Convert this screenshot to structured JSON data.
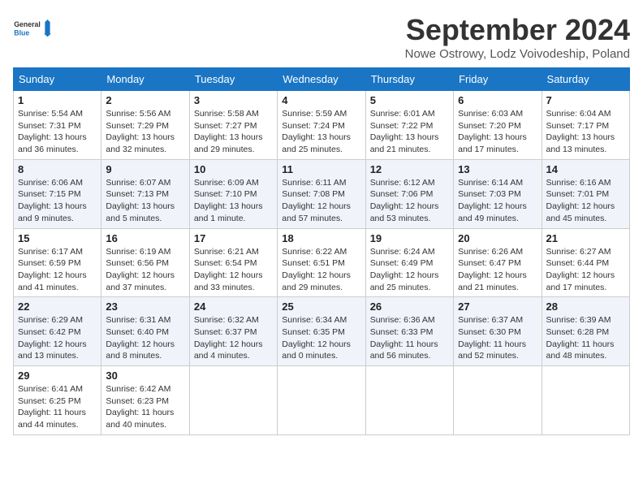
{
  "logo": {
    "line1": "General",
    "line2": "Blue"
  },
  "title": "September 2024",
  "subtitle": "Nowe Ostrowy, Lodz Voivodeship, Poland",
  "days_of_week": [
    "Sunday",
    "Monday",
    "Tuesday",
    "Wednesday",
    "Thursday",
    "Friday",
    "Saturday"
  ],
  "weeks": [
    [
      {
        "day": 1,
        "sunrise": "5:54 AM",
        "sunset": "7:31 PM",
        "daylight": "13 hours and 36 minutes."
      },
      {
        "day": 2,
        "sunrise": "5:56 AM",
        "sunset": "7:29 PM",
        "daylight": "13 hours and 32 minutes."
      },
      {
        "day": 3,
        "sunrise": "5:58 AM",
        "sunset": "7:27 PM",
        "daylight": "13 hours and 29 minutes."
      },
      {
        "day": 4,
        "sunrise": "5:59 AM",
        "sunset": "7:24 PM",
        "daylight": "13 hours and 25 minutes."
      },
      {
        "day": 5,
        "sunrise": "6:01 AM",
        "sunset": "7:22 PM",
        "daylight": "13 hours and 21 minutes."
      },
      {
        "day": 6,
        "sunrise": "6:03 AM",
        "sunset": "7:20 PM",
        "daylight": "13 hours and 17 minutes."
      },
      {
        "day": 7,
        "sunrise": "6:04 AM",
        "sunset": "7:17 PM",
        "daylight": "13 hours and 13 minutes."
      }
    ],
    [
      {
        "day": 8,
        "sunrise": "6:06 AM",
        "sunset": "7:15 PM",
        "daylight": "13 hours and 9 minutes."
      },
      {
        "day": 9,
        "sunrise": "6:07 AM",
        "sunset": "7:13 PM",
        "daylight": "13 hours and 5 minutes."
      },
      {
        "day": 10,
        "sunrise": "6:09 AM",
        "sunset": "7:10 PM",
        "daylight": "13 hours and 1 minute."
      },
      {
        "day": 11,
        "sunrise": "6:11 AM",
        "sunset": "7:08 PM",
        "daylight": "12 hours and 57 minutes."
      },
      {
        "day": 12,
        "sunrise": "6:12 AM",
        "sunset": "7:06 PM",
        "daylight": "12 hours and 53 minutes."
      },
      {
        "day": 13,
        "sunrise": "6:14 AM",
        "sunset": "7:03 PM",
        "daylight": "12 hours and 49 minutes."
      },
      {
        "day": 14,
        "sunrise": "6:16 AM",
        "sunset": "7:01 PM",
        "daylight": "12 hours and 45 minutes."
      }
    ],
    [
      {
        "day": 15,
        "sunrise": "6:17 AM",
        "sunset": "6:59 PM",
        "daylight": "12 hours and 41 minutes."
      },
      {
        "day": 16,
        "sunrise": "6:19 AM",
        "sunset": "6:56 PM",
        "daylight": "12 hours and 37 minutes."
      },
      {
        "day": 17,
        "sunrise": "6:21 AM",
        "sunset": "6:54 PM",
        "daylight": "12 hours and 33 minutes."
      },
      {
        "day": 18,
        "sunrise": "6:22 AM",
        "sunset": "6:51 PM",
        "daylight": "12 hours and 29 minutes."
      },
      {
        "day": 19,
        "sunrise": "6:24 AM",
        "sunset": "6:49 PM",
        "daylight": "12 hours and 25 minutes."
      },
      {
        "day": 20,
        "sunrise": "6:26 AM",
        "sunset": "6:47 PM",
        "daylight": "12 hours and 21 minutes."
      },
      {
        "day": 21,
        "sunrise": "6:27 AM",
        "sunset": "6:44 PM",
        "daylight": "12 hours and 17 minutes."
      }
    ],
    [
      {
        "day": 22,
        "sunrise": "6:29 AM",
        "sunset": "6:42 PM",
        "daylight": "12 hours and 13 minutes."
      },
      {
        "day": 23,
        "sunrise": "6:31 AM",
        "sunset": "6:40 PM",
        "daylight": "12 hours and 8 minutes."
      },
      {
        "day": 24,
        "sunrise": "6:32 AM",
        "sunset": "6:37 PM",
        "daylight": "12 hours and 4 minutes."
      },
      {
        "day": 25,
        "sunrise": "6:34 AM",
        "sunset": "6:35 PM",
        "daylight": "12 hours and 0 minutes."
      },
      {
        "day": 26,
        "sunrise": "6:36 AM",
        "sunset": "6:33 PM",
        "daylight": "11 hours and 56 minutes."
      },
      {
        "day": 27,
        "sunrise": "6:37 AM",
        "sunset": "6:30 PM",
        "daylight": "11 hours and 52 minutes."
      },
      {
        "day": 28,
        "sunrise": "6:39 AM",
        "sunset": "6:28 PM",
        "daylight": "11 hours and 48 minutes."
      }
    ],
    [
      {
        "day": 29,
        "sunrise": "6:41 AM",
        "sunset": "6:25 PM",
        "daylight": "11 hours and 44 minutes."
      },
      {
        "day": 30,
        "sunrise": "6:42 AM",
        "sunset": "6:23 PM",
        "daylight": "11 hours and 40 minutes."
      },
      null,
      null,
      null,
      null,
      null
    ]
  ]
}
